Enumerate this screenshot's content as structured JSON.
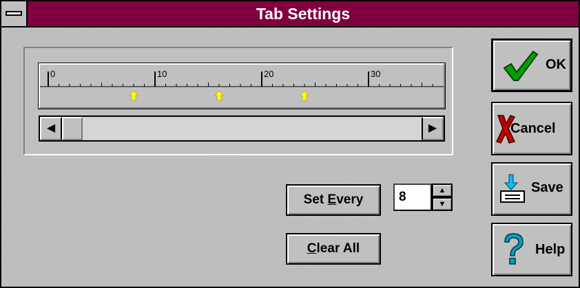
{
  "window": {
    "title": "Tab Settings",
    "system_menu": "system-menu-icon"
  },
  "ruler": {
    "tick_labels": [
      "0",
      "10",
      "20",
      "30"
    ],
    "tab_stops": [
      8,
      16,
      24
    ],
    "tab_marker_color": "#ffff00"
  },
  "scrollbar": {
    "left_arrow": "◀",
    "right_arrow": "▶"
  },
  "controls": {
    "set_every_label_prefix": "Set ",
    "set_every_label_underlined": "E",
    "set_every_label_suffix": "very",
    "set_every_value": "8",
    "spin_up": "▲",
    "spin_down": "▼",
    "clear_all_label_underlined": "C",
    "clear_all_label_suffix": "lear All"
  },
  "buttons": {
    "ok": "OK",
    "cancel": "Cancel",
    "save": "Save",
    "help": "Help"
  },
  "colors": {
    "titlebar": "#800040",
    "ok_check": "#00a000",
    "cancel_x": "#c00000",
    "help_q": "#00a0c0",
    "save_arrow": "#00c0ff"
  }
}
